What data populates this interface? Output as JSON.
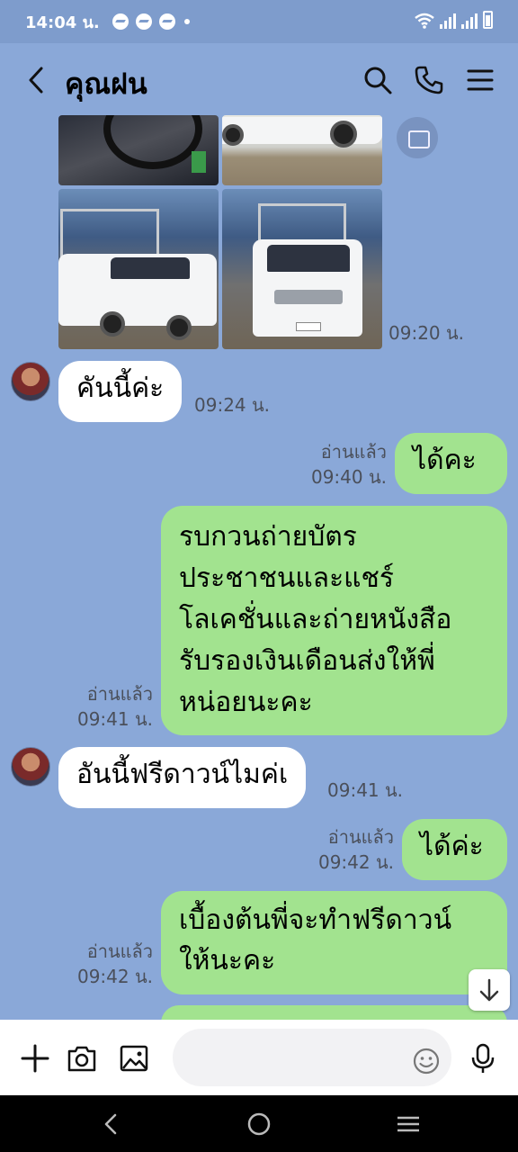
{
  "status": {
    "time": "14:04 น."
  },
  "header": {
    "title": "คุณฝน"
  },
  "messages": {
    "photos_time": "09:20 น.",
    "m1": {
      "text": "คันนี้ค่ะ",
      "time": "09:24 น."
    },
    "m2": {
      "text": "ได้คะ",
      "read": "อ่านแล้ว",
      "time": "09:40 น."
    },
    "m3": {
      "lines": [
        "รบกวนถ่ายบัตร",
        "ประชาชนและแชร์",
        "โลเคชั่นและถ่ายหนังสือ",
        "รับรองเงินเดือนส่งให้พี่",
        "หน่อยนะคะ"
      ],
      "read": "อ่านแล้ว",
      "time": "09:41 น."
    },
    "m4": {
      "text": "อันนี้ฟรีดาวน์ไมค่เ",
      "time": "09:41 น."
    },
    "m5": {
      "text": "ได้ค่ะ",
      "read": "อ่านแล้ว",
      "time": "09:42 น."
    },
    "m6": {
      "lines": [
        "เบื้องต้นพี่จะทำฟรีดาวน์",
        "ให้นะคะ"
      ],
      "read": "อ่านแล้ว",
      "time": "09:42 น."
    }
  },
  "input": {
    "placeholder": ""
  },
  "icons": {
    "back": "chevron-left-icon",
    "search": "search-icon",
    "call": "phone-icon",
    "menu": "menu-icon",
    "add": "plus-icon",
    "camera": "camera-icon",
    "gallery": "image-icon",
    "emoji": "emoji-icon",
    "mic": "mic-icon"
  },
  "colors": {
    "background": "#8aa8d8",
    "incoming": "#ffffff",
    "outgoing": "#a2e38f"
  }
}
